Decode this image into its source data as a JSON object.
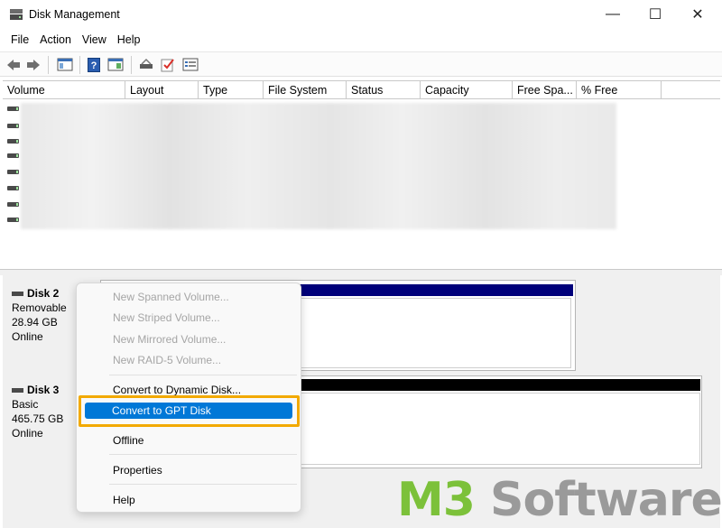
{
  "window": {
    "title": "Disk Management",
    "minimize_glyph": "—",
    "maximize_glyph": "☐",
    "close_glyph": "✕"
  },
  "menu": [
    "File",
    "Action",
    "View",
    "Help"
  ],
  "toolbar": {
    "icons": [
      "back-icon",
      "forward-icon",
      "console-tree-icon",
      "help-icon",
      "show-pane-icon",
      "connect-disk-icon",
      "check-icon",
      "properties-icon"
    ]
  },
  "volume_list": {
    "columns": [
      "Volume",
      "Layout",
      "Type",
      "File System",
      "Status",
      "Capacity",
      "Free Spa...",
      "% Free"
    ],
    "row_count": 7
  },
  "disks": [
    {
      "name": "Disk 2",
      "type": "Removable",
      "size": "28.94 GB",
      "state": "Online"
    },
    {
      "name": "Disk 3",
      "type": "Basic",
      "size": "465.75 GB",
      "state": "Online"
    }
  ],
  "context_menu": {
    "items": [
      {
        "label": "New Spanned Volume...",
        "enabled": false
      },
      {
        "label": "New Striped Volume...",
        "enabled": false
      },
      {
        "label": "New Mirrored Volume...",
        "enabled": false
      },
      {
        "label": "New RAID-5 Volume...",
        "enabled": false
      },
      {
        "label": "Convert to Dynamic Disk...",
        "enabled": true
      },
      {
        "label": "Convert to GPT Disk",
        "enabled": true,
        "highlighted": true
      },
      {
        "label": "Offline",
        "enabled": true
      },
      {
        "label": "Properties",
        "enabled": true
      },
      {
        "label": "Help",
        "enabled": true
      }
    ]
  },
  "watermark": {
    "part1": "M3",
    "part2": " Software"
  },
  "colors": {
    "highlight": "#0078d7",
    "highlight_frame": "#f2a900",
    "volume_bar_blue": "#00007a",
    "watermark_green": "#7cc13a",
    "watermark_gray": "#9a9a9a"
  }
}
